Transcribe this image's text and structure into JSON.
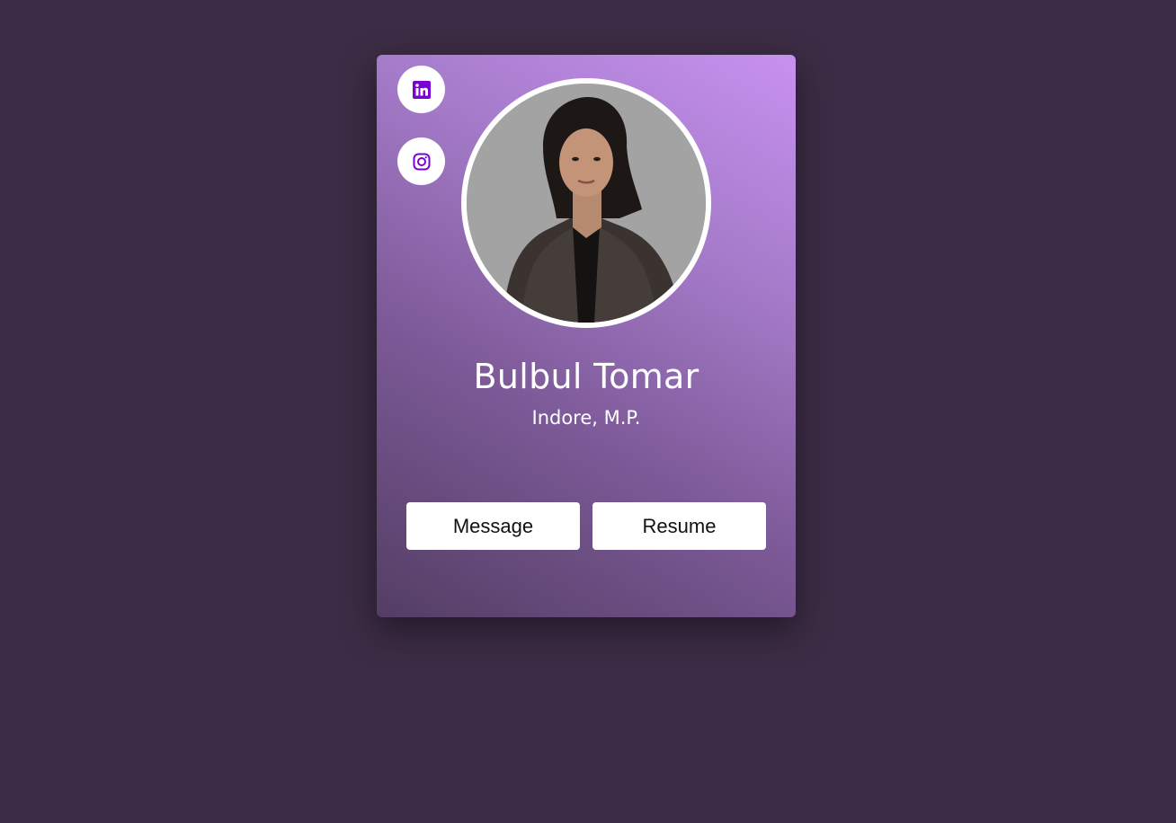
{
  "profile": {
    "name": "Bulbul Tomar",
    "location": "Indore, M.P."
  },
  "buttons": {
    "message_label": "Message",
    "resume_label": "Resume"
  },
  "social": [
    {
      "icon": "linkedin-icon",
      "color": "#7b00d4"
    },
    {
      "icon": "instagram-icon",
      "color": "#7b00d4"
    }
  ],
  "colors": {
    "page_background": "#3c2c45",
    "card_gradient": [
      "#c791f0",
      "#a47ac8",
      "#7d5a98",
      "#533e64"
    ],
    "avatar_background": "#a3a3a3"
  }
}
